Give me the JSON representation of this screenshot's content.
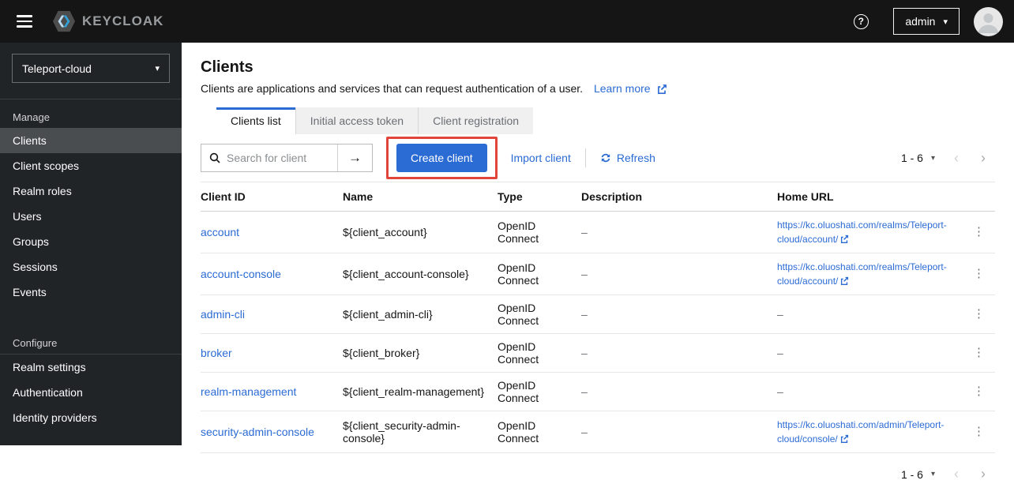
{
  "colors": {
    "masthead-bg": "#151515",
    "sidebar-bg": "#212427",
    "nav-active-bg": "#4a4d50",
    "accent": "#2b6bd4",
    "link": "#2b6bd4",
    "annotation": "#e0443a"
  },
  "masthead": {
    "brand": "KEYCLOAK",
    "help_glyph": "?",
    "username": "admin",
    "caret_glyph": "▾"
  },
  "sidebar": {
    "realm_selector": "Teleport-cloud",
    "sections": [
      {
        "title": "Manage",
        "items": [
          {
            "label": "Clients"
          },
          {
            "label": "Client scopes"
          },
          {
            "label": "Realm roles"
          },
          {
            "label": "Users"
          },
          {
            "label": "Groups"
          },
          {
            "label": "Sessions"
          },
          {
            "label": "Events"
          }
        ]
      },
      {
        "title": "Configure",
        "items": [
          {
            "label": "Realm settings"
          },
          {
            "label": "Authentication"
          },
          {
            "label": "Identity providers"
          }
        ]
      }
    ]
  },
  "main": {
    "title": "Clients",
    "description": "Clients are applications and services that can request authentication of a user.",
    "learn_more_label": "Learn more",
    "tabs": [
      {
        "label": "Clients list"
      },
      {
        "label": "Initial access token"
      },
      {
        "label": "Client registration"
      }
    ],
    "toolbar": {
      "search_placeholder": "Search for client",
      "arrow_glyph": "→",
      "create_button": "Create client",
      "import_button": "Import client",
      "refresh_button": "Refresh"
    },
    "pagination": {
      "range_label": "1 - 6",
      "caret_glyph": "▾",
      "prev_glyph": "‹",
      "next_glyph": "›"
    },
    "table": {
      "columns": [
        "Client ID",
        "Name",
        "Type",
        "Description",
        "Home URL"
      ],
      "kebab_glyph": "⋮",
      "rows": [
        {
          "client_id": "account",
          "name": "${client_account}",
          "type": "OpenID Connect",
          "description": "–",
          "home_url": "https://kc.oluoshati.com/realms/Teleport-cloud/account/"
        },
        {
          "client_id": "account-console",
          "name": "${client_account-console}",
          "type": "OpenID Connect",
          "description": "–",
          "home_url": "https://kc.oluoshati.com/realms/Teleport-cloud/account/"
        },
        {
          "client_id": "admin-cli",
          "name": "${client_admin-cli}",
          "type": "OpenID Connect",
          "description": "–",
          "home_url": "–"
        },
        {
          "client_id": "broker",
          "name": "${client_broker}",
          "type": "OpenID Connect",
          "description": "–",
          "home_url": "–"
        },
        {
          "client_id": "realm-management",
          "name": "${client_realm-management}",
          "type": "OpenID Connect",
          "description": "–",
          "home_url": "–"
        },
        {
          "client_id": "security-admin-console",
          "name": "${client_security-admin-console}",
          "type": "OpenID Connect",
          "description": "–",
          "home_url": "https://kc.oluoshati.com/admin/Teleport-cloud/console/"
        }
      ]
    }
  }
}
